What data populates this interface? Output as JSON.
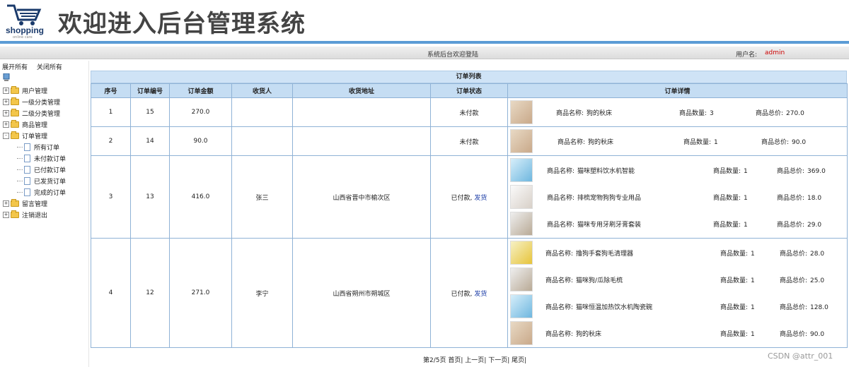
{
  "header": {
    "logo_text": "shopping",
    "logo_sub": "online care",
    "title": "欢迎进入后台管理系统"
  },
  "status_bar": {
    "welcome": "系统后台欢迎登陆",
    "user_label": "用户名:",
    "user_name": "admin"
  },
  "sidebar": {
    "expand_all": "展开所有",
    "collapse_all": "关闭所有",
    "menus": [
      {
        "label": "用户管理"
      },
      {
        "label": "一级分类管理"
      },
      {
        "label": "二级分类管理"
      },
      {
        "label": "商品管理"
      },
      {
        "label": "订单管理"
      },
      {
        "label": "留言管理"
      },
      {
        "label": "注销退出"
      }
    ],
    "order_children": [
      "所有订单",
      "未付款订单",
      "已付款订单",
      "已发货订单",
      "完成的订单"
    ]
  },
  "table": {
    "title": "订单列表",
    "columns": [
      "序号",
      "订单编号",
      "订单金额",
      "收货人",
      "收货地址",
      "订单状态",
      "订单详情"
    ],
    "name_label": "商品名称:",
    "qty_label": "商品数量:",
    "total_label": "商品总价:",
    "rows": [
      {
        "idx": "1",
        "order_no": "15",
        "amount": "270.0",
        "receiver": "",
        "address": "",
        "status": "未付款",
        "ship": "",
        "items": [
          {
            "name": "狗的秋床",
            "qty": "3",
            "total": "270.0",
            "thumb": "brown"
          }
        ]
      },
      {
        "idx": "2",
        "order_no": "14",
        "amount": "90.0",
        "receiver": "",
        "address": "",
        "status": "未付款",
        "ship": "",
        "items": [
          {
            "name": "狗的秋床",
            "qty": "1",
            "total": "90.0",
            "thumb": "brown"
          }
        ]
      },
      {
        "idx": "3",
        "order_no": "13",
        "amount": "416.0",
        "receiver": "张三",
        "address": "山西省晋中市榆次区",
        "status": "已付款,",
        "ship": "发货",
        "items": [
          {
            "name": "猫咪塑料饮水机智能",
            "qty": "1",
            "total": "369.0",
            "thumb": "blue"
          },
          {
            "name": "排梳宠物狗狗专业用品",
            "qty": "1",
            "total": "18.0",
            "thumb": "white"
          },
          {
            "name": "猫咪专用牙刷牙膏套装",
            "qty": "1",
            "total": "29.0",
            "thumb": "gray"
          }
        ]
      },
      {
        "idx": "4",
        "order_no": "12",
        "amount": "271.0",
        "receiver": "李宁",
        "address": "山西省朔州市朔城区",
        "status": "已付款,",
        "ship": "发货",
        "items": [
          {
            "name": "撸狗手套狗毛清理器",
            "qty": "1",
            "total": "28.0",
            "thumb": "yellow"
          },
          {
            "name": "猫咪狗/瓜除毛梳",
            "qty": "1",
            "total": "25.0",
            "thumb": "gray"
          },
          {
            "name": "猫咪恒温加热饮水机陶瓷碗",
            "qty": "1",
            "total": "128.0",
            "thumb": "blue"
          },
          {
            "name": "狗的秋床",
            "qty": "1",
            "total": "90.0",
            "thumb": "brown"
          }
        ]
      }
    ]
  },
  "pager": {
    "page_info": "第2/5页",
    "first": "首页",
    "prev": "上一页",
    "next": "下一页",
    "last": "尾页"
  },
  "watermark": "CSDN @attr_001"
}
